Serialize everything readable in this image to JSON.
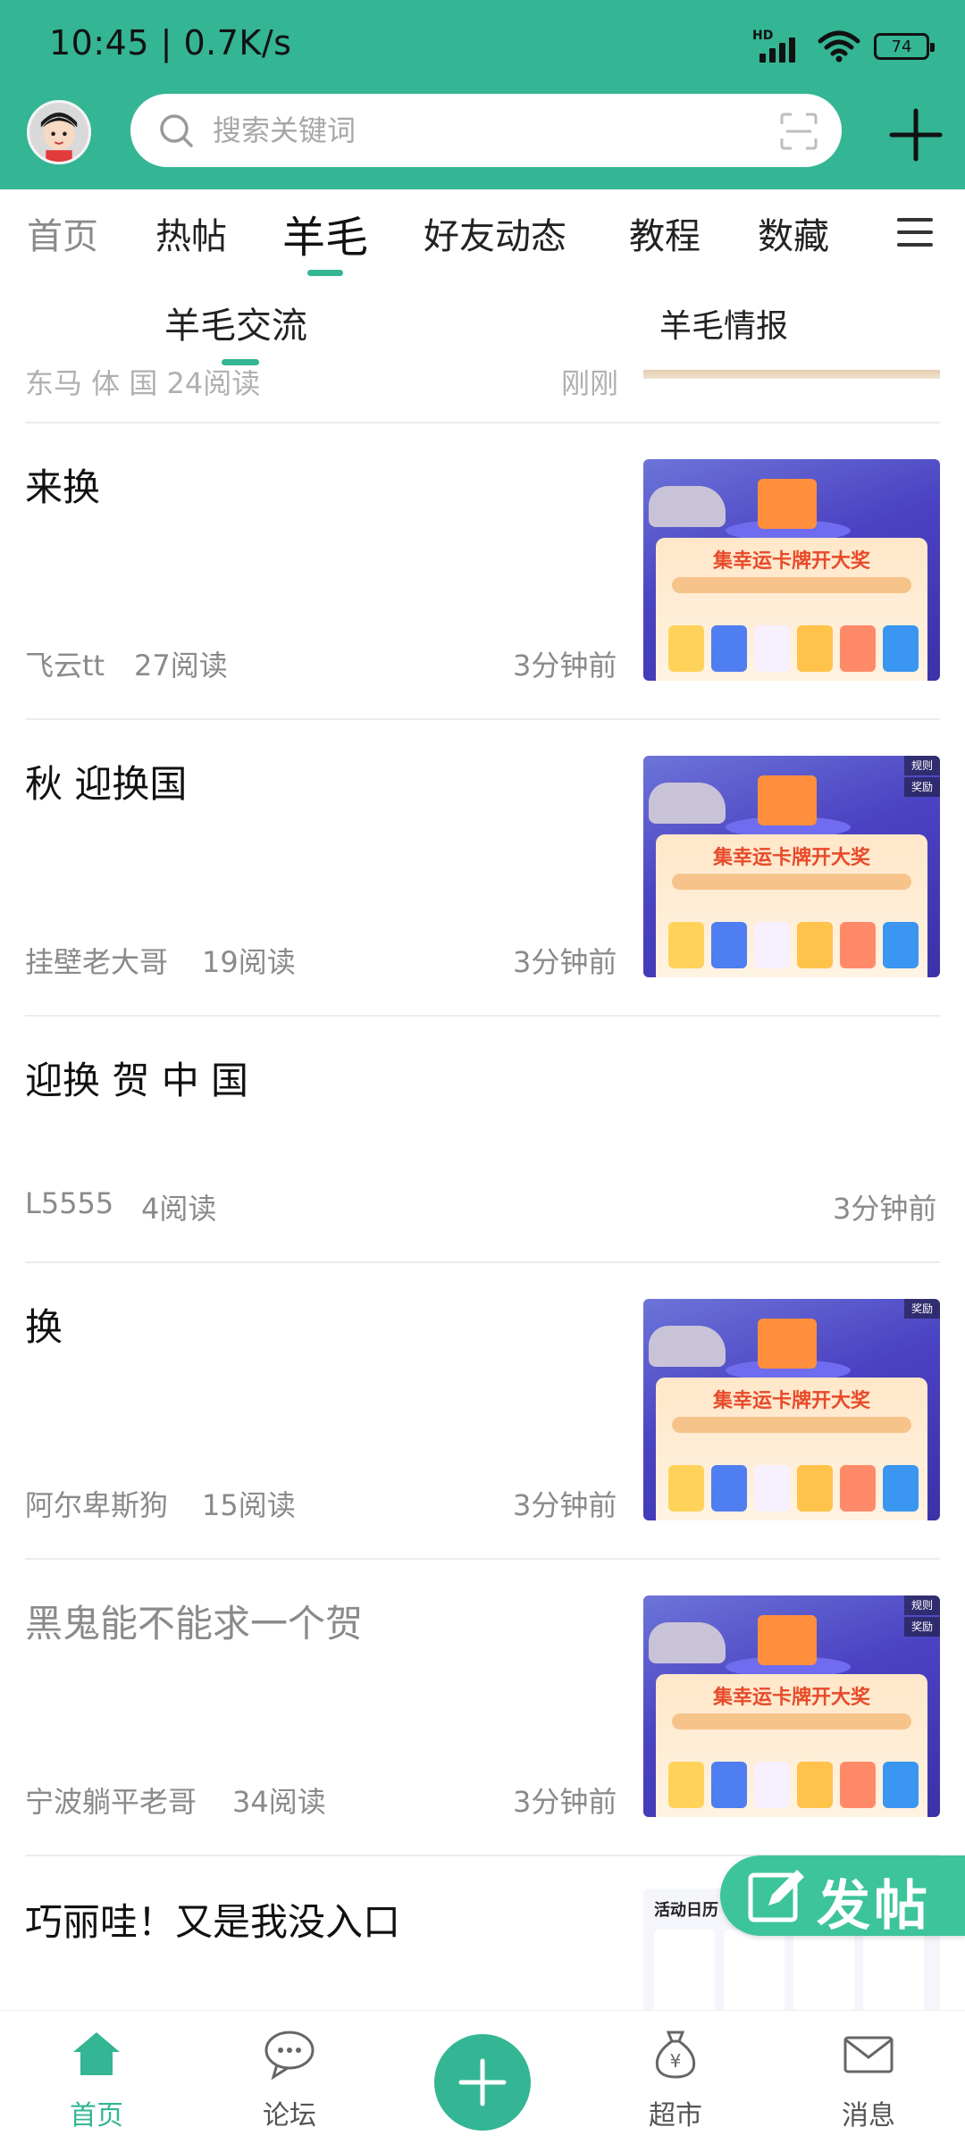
{
  "status_bar": {
    "time": "10:45 | 0.7K/s",
    "network": "HD",
    "battery": "74"
  },
  "search": {
    "placeholder": "搜索关键词"
  },
  "main_tabs": [
    "首页",
    "热帖",
    "羊毛",
    "好友动态",
    "教程",
    "数藏"
  ],
  "active_main_tab": "羊毛",
  "sub_tabs": [
    "羊毛交流",
    "羊毛情报"
  ],
  "active_sub_tab": "羊毛交流",
  "partial_post": {
    "meta": "东马 体 国   24阅读",
    "time": "刚刚"
  },
  "posts": [
    {
      "title": "来换",
      "author": "飞云tt",
      "reads": "27阅读",
      "time": "3分钟前",
      "has_image": true
    },
    {
      "title": "秋 迎换国",
      "author": "挂壁老大哥",
      "reads": "19阅读",
      "time": "3分钟前",
      "has_image": true
    },
    {
      "title": "迎换 贺 中 国",
      "author": "L5555",
      "reads": "4阅读",
      "time": "3分钟前",
      "has_image": false
    },
    {
      "title": "换",
      "author": "阿尔卑斯狗",
      "reads": "15阅读",
      "time": "3分钟前",
      "has_image": true
    },
    {
      "title": "黑鬼能不能求一个贺",
      "author": "宁波躺平老哥",
      "reads": "34阅读",
      "time": "3分钟前",
      "has_image": true
    },
    {
      "title": "巧丽哇！又是我没入口",
      "author": "",
      "reads": "",
      "time": "",
      "has_image": true
    }
  ],
  "thumbnail_banner": "集幸运卡牌开大奖",
  "thumbnail_tags": {
    "rules": "规则",
    "prize": "奖励"
  },
  "calendar_thumb_title": "活动日历",
  "float_button": {
    "label": "发帖"
  },
  "bottom_nav": [
    {
      "label": "首页",
      "icon": "home-icon",
      "active": true
    },
    {
      "label": "论坛",
      "icon": "chat-bubble-icon",
      "active": false
    },
    {
      "label": "",
      "icon": "plus-icon",
      "active": false
    },
    {
      "label": "超市",
      "icon": "money-bag-icon",
      "active": false
    },
    {
      "label": "消息",
      "icon": "mail-icon",
      "active": false
    }
  ],
  "colors": {
    "accent": "#34b594",
    "float_button": "#3dc49a",
    "text": "#111111",
    "muted": "#8a8a8a"
  }
}
